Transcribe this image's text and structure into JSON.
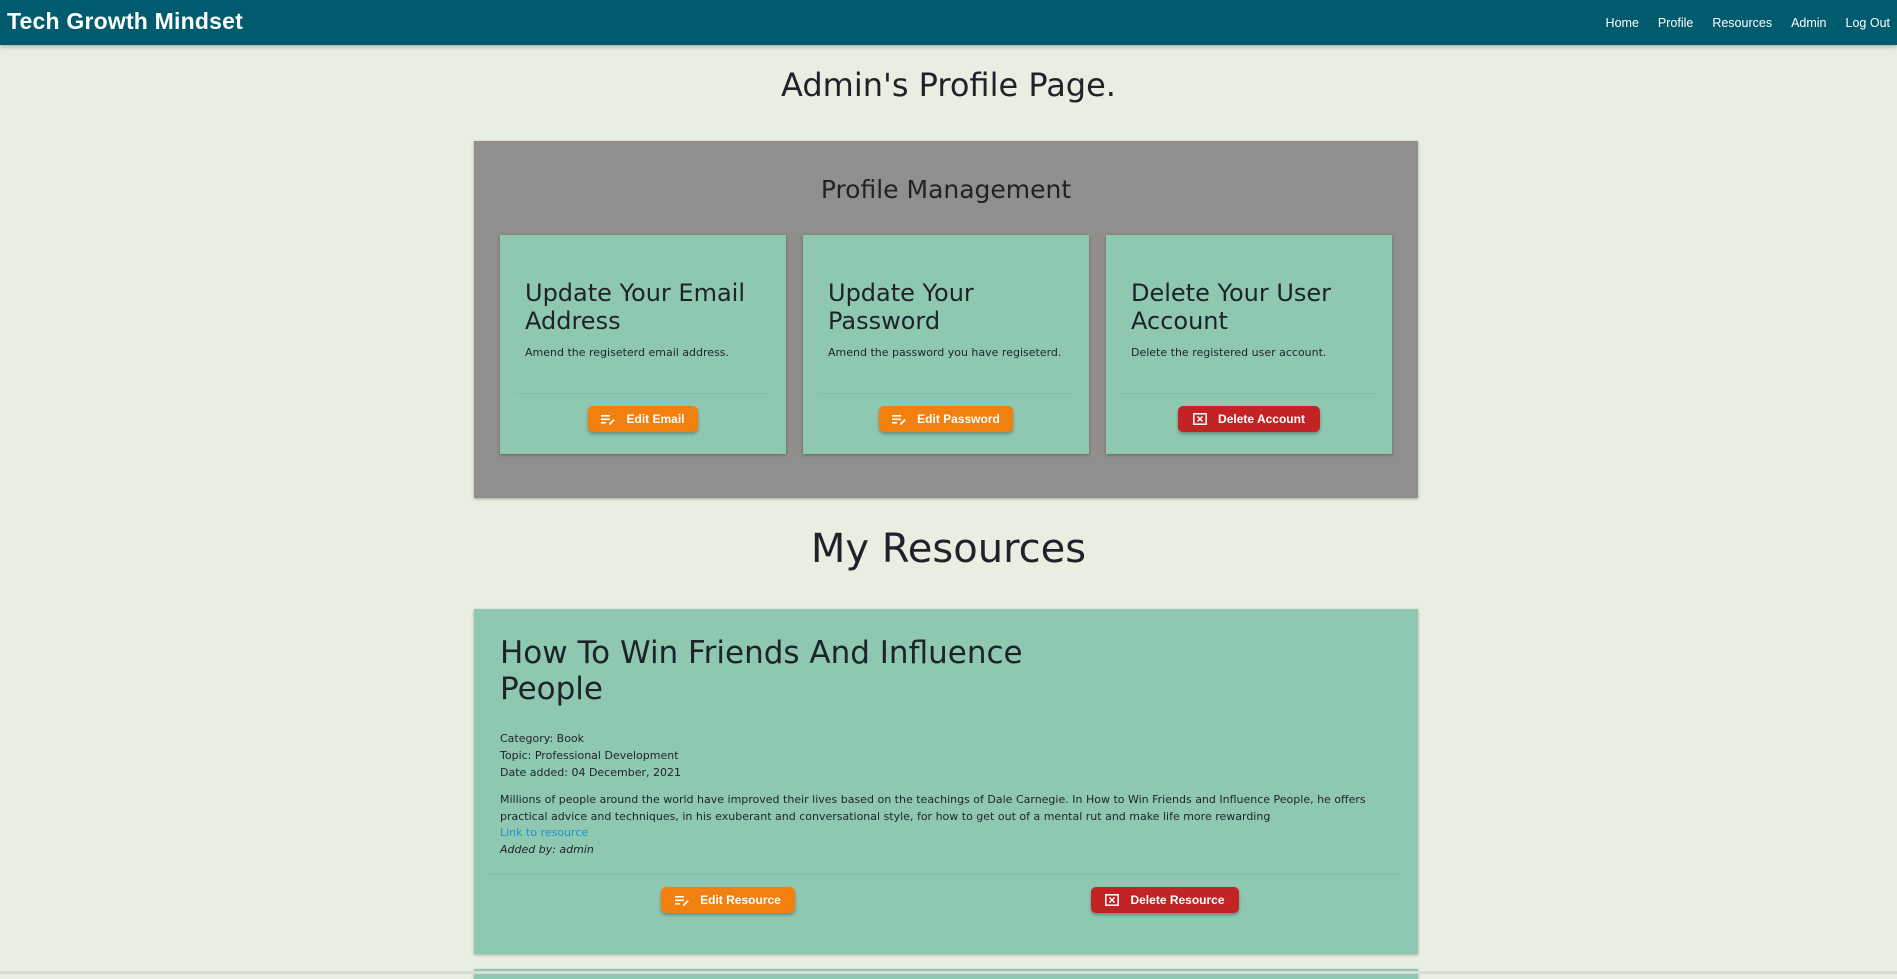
{
  "navbar": {
    "brand": "Tech Growth Mindset",
    "links": [
      "Home",
      "Profile",
      "Resources",
      "Admin",
      "Log Out"
    ]
  },
  "page_title": "Admin's Profile Page.",
  "profile_management": {
    "title": "Profile Management",
    "cards": [
      {
        "heading": "Update Your Email Address",
        "text": "Amend the regiseterd email address.",
        "button": "Edit Email",
        "button_icon": "edit-icon"
      },
      {
        "heading": "Update Your Password",
        "text": "Amend the password you have regiseterd.",
        "button": "Edit Password",
        "button_icon": "edit-icon"
      },
      {
        "heading": "Delete Your User Account",
        "text": "Delete the registered user account.",
        "button": "Delete Account",
        "button_icon": "delete-box-icon"
      }
    ]
  },
  "resources": {
    "title": "My Resources",
    "items": [
      {
        "title": "How To Win Friends And Influence People",
        "category": "Category: Book",
        "topic": "Topic: Professional Development",
        "date_added": "Date added: 04 December, 2021",
        "description": "Millions of people around the world have improved their lives based on the teachings of Dale Carnegie. In How to Win Friends and Influence People, he offers practical advice and techniques, in his exuberant and conversational style, for how to get out of a mental rut and make life more rewarding",
        "link_text": "Link to resource",
        "added_by": "Added by: admin",
        "edit_button": "Edit Resource",
        "delete_button": "Delete Resource"
      }
    ]
  },
  "colors": {
    "navbar": "#005b6e",
    "background": "#e8efe2",
    "panel": "#918f8d",
    "card": "#8fc8b1",
    "button_orange": "#f2800f",
    "button_red": "#c22325",
    "link": "#1f8fd3"
  }
}
